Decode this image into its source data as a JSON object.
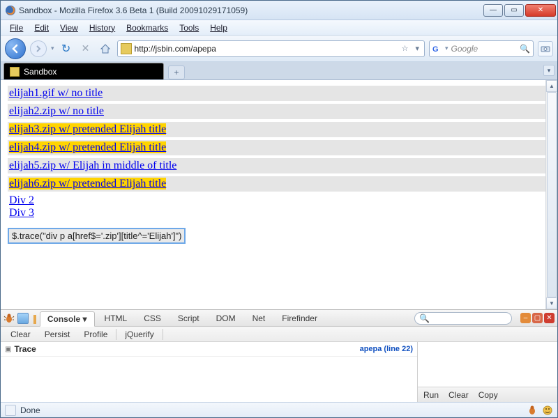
{
  "window": {
    "title": "Sandbox - Mozilla Firefox 3.6 Beta 1 (Build 20091029171059)"
  },
  "menubar": [
    "File",
    "Edit",
    "View",
    "History",
    "Bookmarks",
    "Tools",
    "Help"
  ],
  "url": "http://jsbin.com/apepa",
  "search_placeholder": "Google",
  "tab": {
    "title": "Sandbox"
  },
  "page": {
    "links": [
      {
        "text": "elijah1.gif w/ no title",
        "highlight": false
      },
      {
        "text": "elijah2.zip w/ no title",
        "highlight": false
      },
      {
        "text": "elijah3.zip w/ pretended Elijah title",
        "highlight": true
      },
      {
        "text": "elijah4.zip w/ pretended Elijah title",
        "highlight": true
      },
      {
        "text": "elijah5.zip w/ Elijah in middle of title",
        "highlight": false
      },
      {
        "text": "elijah6.zip w/ pretended Elijah title",
        "highlight": true
      }
    ],
    "divs": [
      "Div 2",
      "Div 3"
    ],
    "trace": "$.trace(\"div p a[href$='.zip'][title^='Elijah']\")"
  },
  "firebug": {
    "tabs": [
      "Console",
      "HTML",
      "CSS",
      "Script",
      "DOM",
      "Net",
      "Firefinder"
    ],
    "active_tab": 0,
    "subbar": [
      "Clear",
      "Persist",
      "Profile",
      "jQuerify"
    ],
    "row": {
      "label": "Trace",
      "source": "apepa (line 22)"
    },
    "right_actions": [
      "Run",
      "Clear",
      "Copy"
    ]
  },
  "status": "Done"
}
